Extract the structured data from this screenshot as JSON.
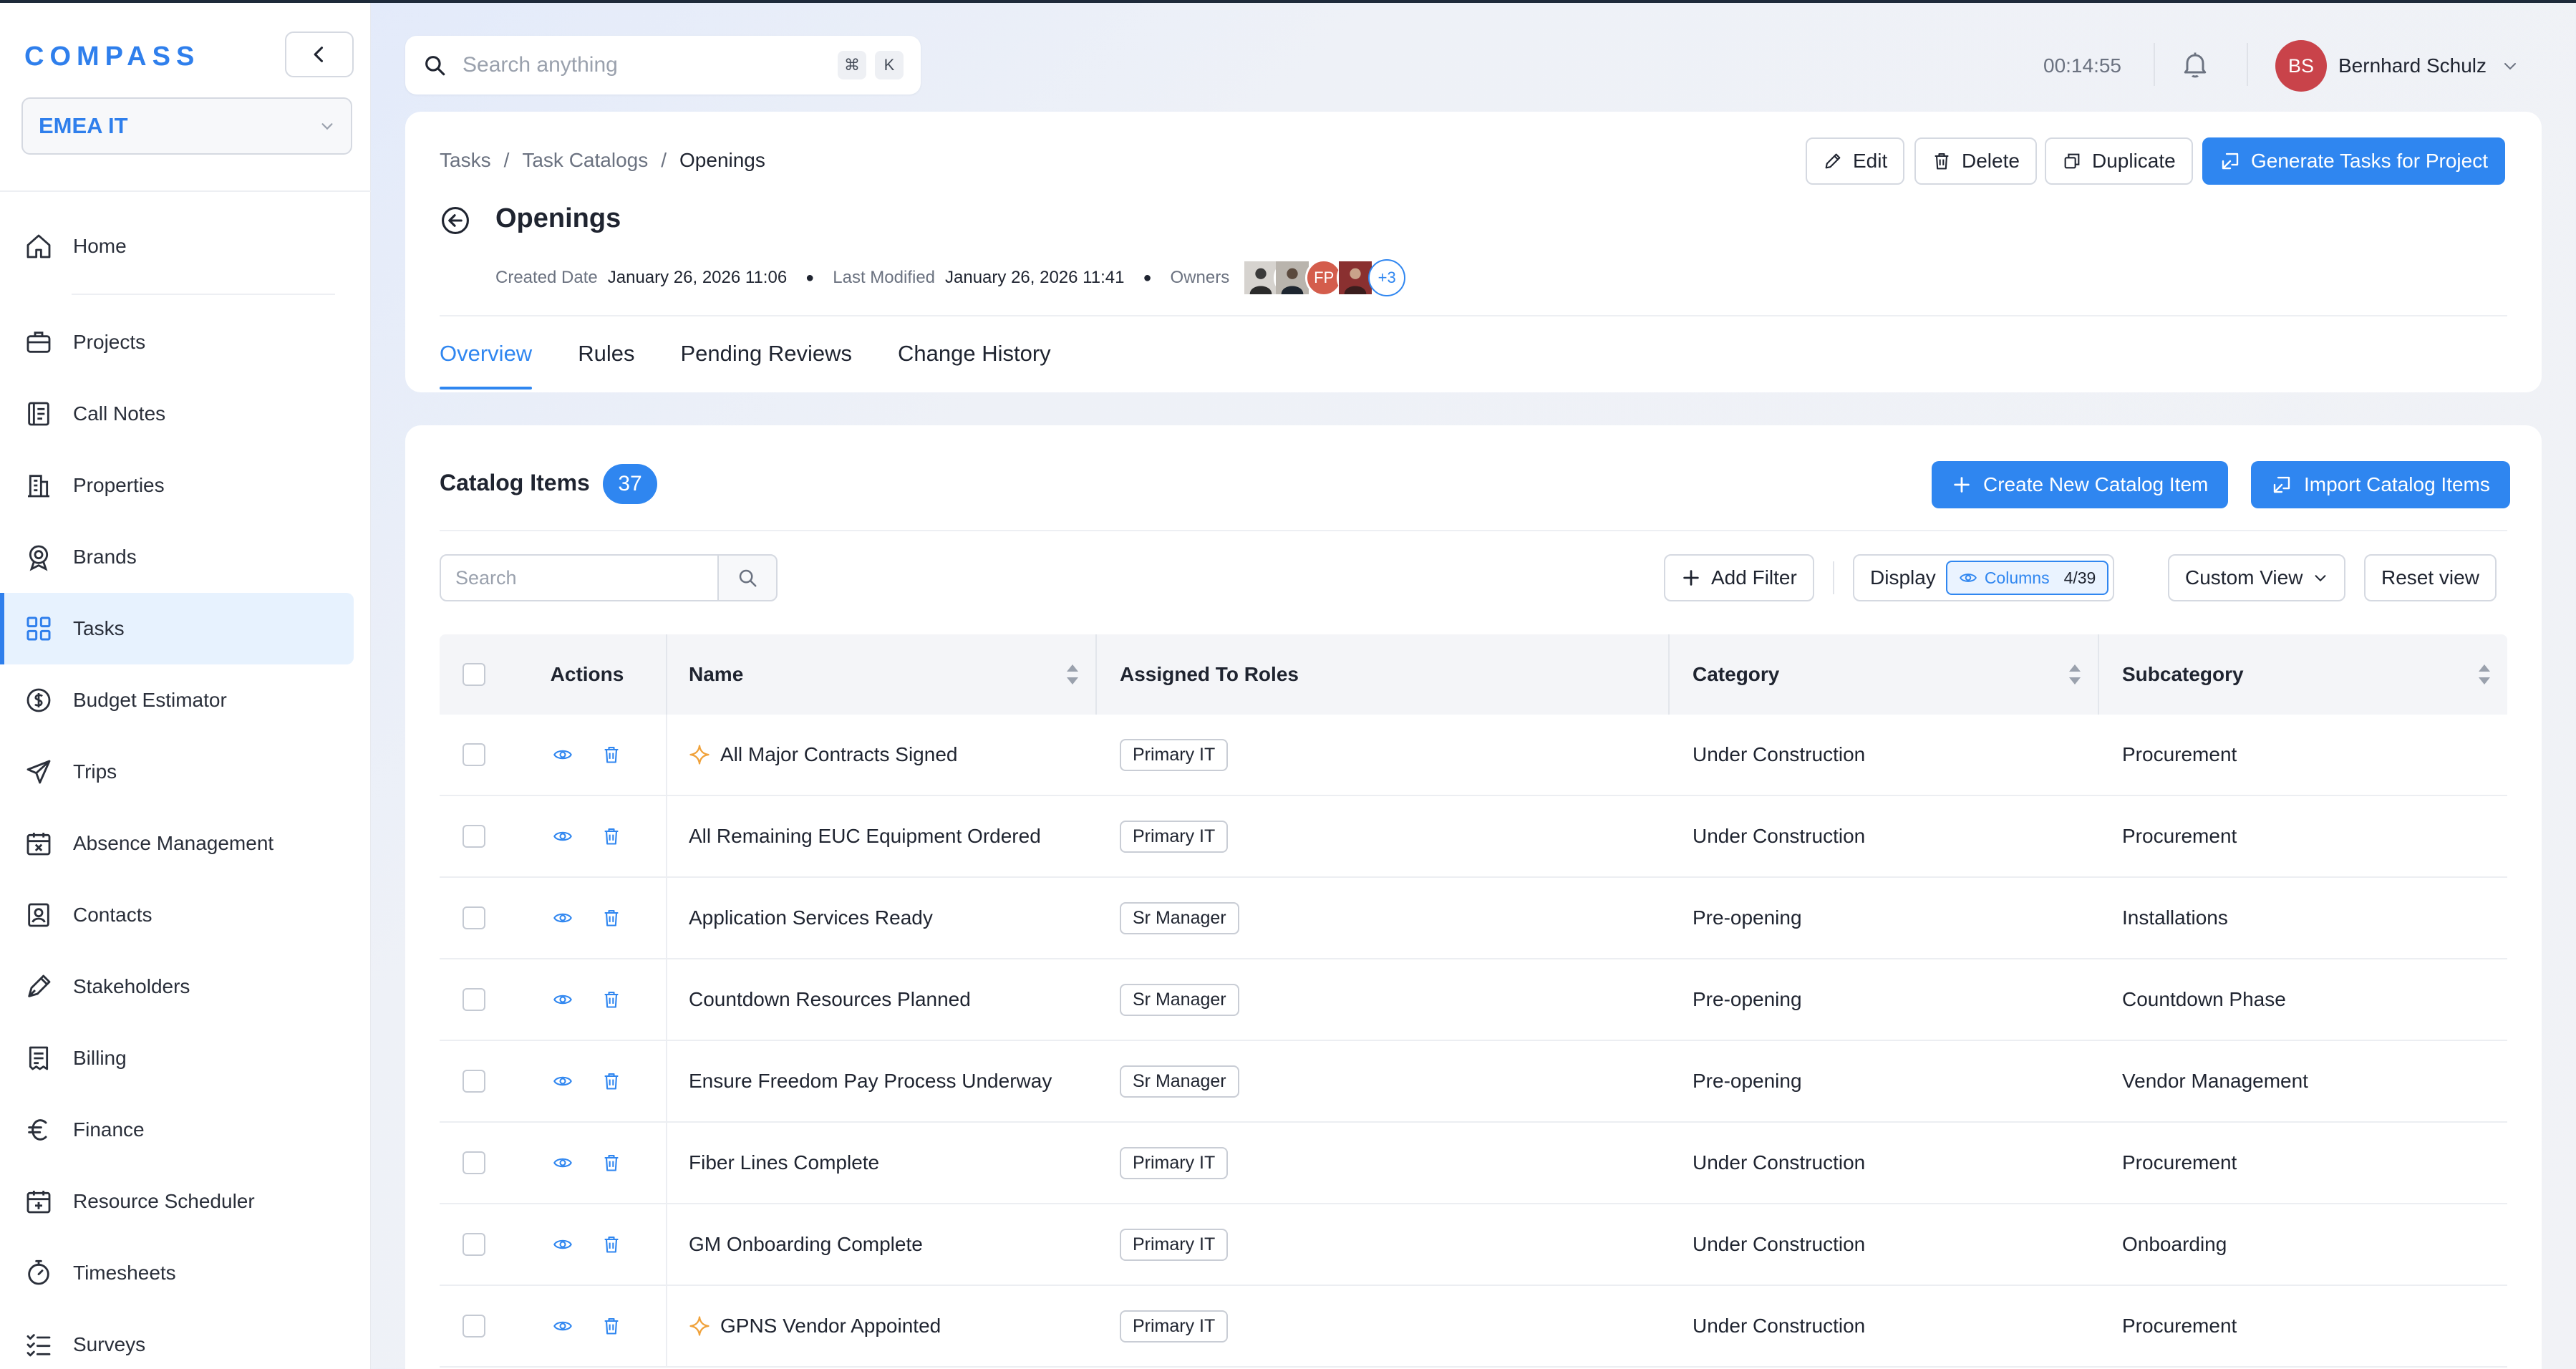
{
  "app": {
    "logo": "COMPASS",
    "org": "EMEA IT"
  },
  "sidebar": {
    "items": [
      {
        "label": "Home",
        "icon": "home-icon"
      },
      {
        "label": "Projects",
        "icon": "briefcase-icon"
      },
      {
        "label": "Call Notes",
        "icon": "notebook-icon"
      },
      {
        "label": "Properties",
        "icon": "building-icon"
      },
      {
        "label": "Brands",
        "icon": "badge-icon"
      },
      {
        "label": "Tasks",
        "icon": "grid-icon",
        "active": true
      },
      {
        "label": "Budget Estimator",
        "icon": "dollar-icon"
      },
      {
        "label": "Trips",
        "icon": "plane-icon"
      },
      {
        "label": "Absence Management",
        "icon": "calendar-x-icon"
      },
      {
        "label": "Contacts",
        "icon": "contact-card-icon"
      },
      {
        "label": "Stakeholders",
        "icon": "pen-icon"
      },
      {
        "label": "Billing",
        "icon": "receipt-icon"
      },
      {
        "label": "Finance",
        "icon": "euro-icon"
      },
      {
        "label": "Resource Scheduler",
        "icon": "calendar-plus-icon"
      },
      {
        "label": "Timesheets",
        "icon": "stopwatch-icon"
      },
      {
        "label": "Surveys",
        "icon": "list-check-icon"
      }
    ]
  },
  "topbar": {
    "search_placeholder": "Search anything",
    "shortcut_cmd": "⌘",
    "shortcut_key": "K",
    "timer": "00:14:55",
    "user_initials": "BS",
    "user_name": "Bernhard Schulz"
  },
  "header": {
    "breadcrumb": [
      "Tasks",
      "Task Catalogs",
      "Openings"
    ],
    "breadcrumb_sep": "/",
    "title": "Openings",
    "created_label": "Created Date",
    "created_value": "January 26, 2026 11:06",
    "modified_label": "Last Modified",
    "modified_value": "January 26, 2026 11:41",
    "owners_label": "Owners",
    "owner_initials_fp": "FP",
    "owners_more": "+3",
    "buttons": {
      "edit": "Edit",
      "delete": "Delete",
      "duplicate": "Duplicate",
      "generate": "Generate Tasks for Project"
    },
    "tabs": [
      "Overview",
      "Rules",
      "Pending Reviews",
      "Change History"
    ]
  },
  "catalog": {
    "title": "Catalog Items",
    "count": "37",
    "create_btn": "Create New Catalog Item",
    "import_btn": "Import Catalog Items",
    "search_placeholder": "Search",
    "add_filter": "Add Filter",
    "display": "Display",
    "columns_label": "Columns",
    "columns_count": "4/39",
    "custom_view": "Custom View",
    "reset_view": "Reset view",
    "columns": {
      "actions": "Actions",
      "name": "Name",
      "roles": "Assigned To Roles",
      "category": "Category",
      "subcategory": "Subcategory"
    },
    "rows": [
      {
        "name": "All Major Contracts Signed",
        "role": "Primary IT",
        "category": "Under Construction",
        "subcategory": "Procurement",
        "star": true
      },
      {
        "name": "All Remaining EUC Equipment Ordered",
        "role": "Primary IT",
        "category": "Under Construction",
        "subcategory": "Procurement",
        "star": false
      },
      {
        "name": "Application Services Ready",
        "role": "Sr Manager",
        "category": "Pre-opening",
        "subcategory": "Installations",
        "star": false
      },
      {
        "name": "Countdown Resources Planned",
        "role": "Sr Manager",
        "category": "Pre-opening",
        "subcategory": "Countdown Phase",
        "star": false
      },
      {
        "name": "Ensure Freedom Pay Process Underway",
        "role": "Sr Manager",
        "category": "Pre-opening",
        "subcategory": "Vendor Management",
        "star": false
      },
      {
        "name": "Fiber Lines Complete",
        "role": "Primary IT",
        "category": "Under Construction",
        "subcategory": "Procurement",
        "star": false
      },
      {
        "name": "GM Onboarding Complete",
        "role": "Primary IT",
        "category": "Under Construction",
        "subcategory": "Onboarding",
        "star": false
      },
      {
        "name": "GPNS Vendor Appointed",
        "role": "Primary IT",
        "category": "Under Construction",
        "subcategory": "Procurement",
        "star": true
      }
    ]
  },
  "colors": {
    "accent": "#2f86f0",
    "logo": "#2f7fec",
    "avatar": "#c9434a",
    "star": "#f0a23b"
  }
}
